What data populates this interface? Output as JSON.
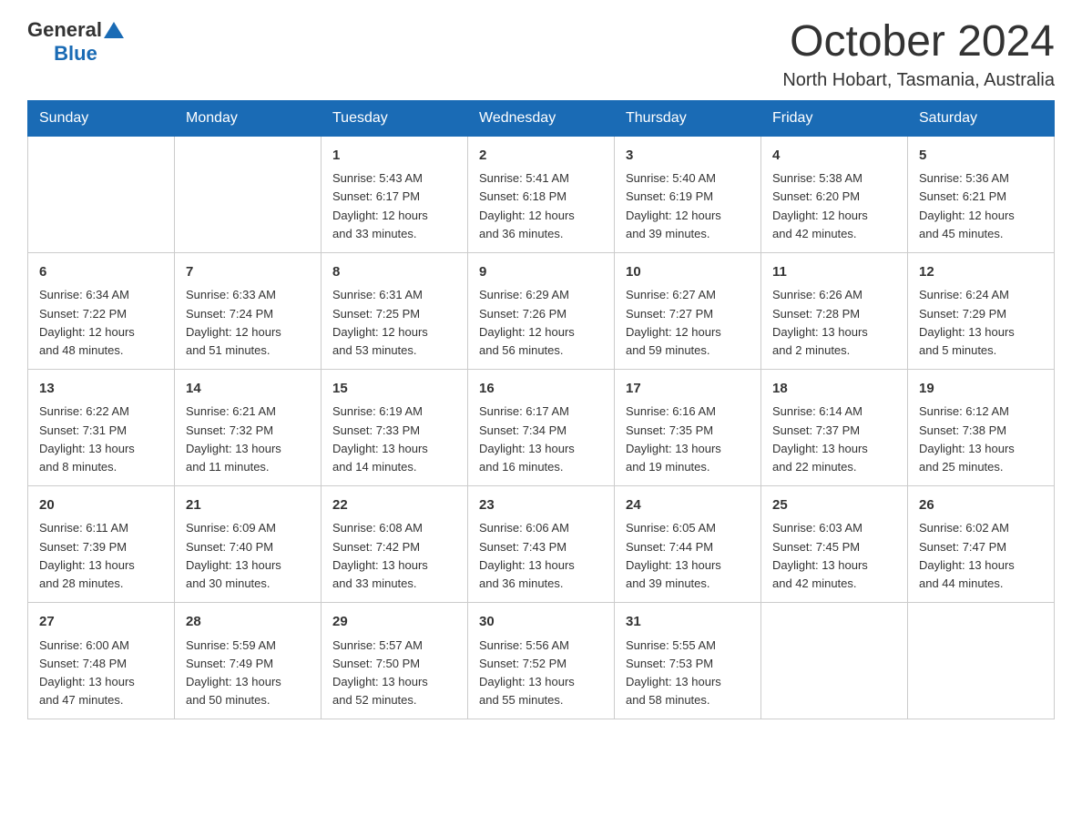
{
  "header": {
    "logo_general": "General",
    "logo_blue": "Blue",
    "month_year": "October 2024",
    "location": "North Hobart, Tasmania, Australia"
  },
  "days_of_week": [
    "Sunday",
    "Monday",
    "Tuesday",
    "Wednesday",
    "Thursday",
    "Friday",
    "Saturday"
  ],
  "weeks": [
    [
      {
        "day": "",
        "info": ""
      },
      {
        "day": "",
        "info": ""
      },
      {
        "day": "1",
        "info": "Sunrise: 5:43 AM\nSunset: 6:17 PM\nDaylight: 12 hours\nand 33 minutes."
      },
      {
        "day": "2",
        "info": "Sunrise: 5:41 AM\nSunset: 6:18 PM\nDaylight: 12 hours\nand 36 minutes."
      },
      {
        "day": "3",
        "info": "Sunrise: 5:40 AM\nSunset: 6:19 PM\nDaylight: 12 hours\nand 39 minutes."
      },
      {
        "day": "4",
        "info": "Sunrise: 5:38 AM\nSunset: 6:20 PM\nDaylight: 12 hours\nand 42 minutes."
      },
      {
        "day": "5",
        "info": "Sunrise: 5:36 AM\nSunset: 6:21 PM\nDaylight: 12 hours\nand 45 minutes."
      }
    ],
    [
      {
        "day": "6",
        "info": "Sunrise: 6:34 AM\nSunset: 7:22 PM\nDaylight: 12 hours\nand 48 minutes."
      },
      {
        "day": "7",
        "info": "Sunrise: 6:33 AM\nSunset: 7:24 PM\nDaylight: 12 hours\nand 51 minutes."
      },
      {
        "day": "8",
        "info": "Sunrise: 6:31 AM\nSunset: 7:25 PM\nDaylight: 12 hours\nand 53 minutes."
      },
      {
        "day": "9",
        "info": "Sunrise: 6:29 AM\nSunset: 7:26 PM\nDaylight: 12 hours\nand 56 minutes."
      },
      {
        "day": "10",
        "info": "Sunrise: 6:27 AM\nSunset: 7:27 PM\nDaylight: 12 hours\nand 59 minutes."
      },
      {
        "day": "11",
        "info": "Sunrise: 6:26 AM\nSunset: 7:28 PM\nDaylight: 13 hours\nand 2 minutes."
      },
      {
        "day": "12",
        "info": "Sunrise: 6:24 AM\nSunset: 7:29 PM\nDaylight: 13 hours\nand 5 minutes."
      }
    ],
    [
      {
        "day": "13",
        "info": "Sunrise: 6:22 AM\nSunset: 7:31 PM\nDaylight: 13 hours\nand 8 minutes."
      },
      {
        "day": "14",
        "info": "Sunrise: 6:21 AM\nSunset: 7:32 PM\nDaylight: 13 hours\nand 11 minutes."
      },
      {
        "day": "15",
        "info": "Sunrise: 6:19 AM\nSunset: 7:33 PM\nDaylight: 13 hours\nand 14 minutes."
      },
      {
        "day": "16",
        "info": "Sunrise: 6:17 AM\nSunset: 7:34 PM\nDaylight: 13 hours\nand 16 minutes."
      },
      {
        "day": "17",
        "info": "Sunrise: 6:16 AM\nSunset: 7:35 PM\nDaylight: 13 hours\nand 19 minutes."
      },
      {
        "day": "18",
        "info": "Sunrise: 6:14 AM\nSunset: 7:37 PM\nDaylight: 13 hours\nand 22 minutes."
      },
      {
        "day": "19",
        "info": "Sunrise: 6:12 AM\nSunset: 7:38 PM\nDaylight: 13 hours\nand 25 minutes."
      }
    ],
    [
      {
        "day": "20",
        "info": "Sunrise: 6:11 AM\nSunset: 7:39 PM\nDaylight: 13 hours\nand 28 minutes."
      },
      {
        "day": "21",
        "info": "Sunrise: 6:09 AM\nSunset: 7:40 PM\nDaylight: 13 hours\nand 30 minutes."
      },
      {
        "day": "22",
        "info": "Sunrise: 6:08 AM\nSunset: 7:42 PM\nDaylight: 13 hours\nand 33 minutes."
      },
      {
        "day": "23",
        "info": "Sunrise: 6:06 AM\nSunset: 7:43 PM\nDaylight: 13 hours\nand 36 minutes."
      },
      {
        "day": "24",
        "info": "Sunrise: 6:05 AM\nSunset: 7:44 PM\nDaylight: 13 hours\nand 39 minutes."
      },
      {
        "day": "25",
        "info": "Sunrise: 6:03 AM\nSunset: 7:45 PM\nDaylight: 13 hours\nand 42 minutes."
      },
      {
        "day": "26",
        "info": "Sunrise: 6:02 AM\nSunset: 7:47 PM\nDaylight: 13 hours\nand 44 minutes."
      }
    ],
    [
      {
        "day": "27",
        "info": "Sunrise: 6:00 AM\nSunset: 7:48 PM\nDaylight: 13 hours\nand 47 minutes."
      },
      {
        "day": "28",
        "info": "Sunrise: 5:59 AM\nSunset: 7:49 PM\nDaylight: 13 hours\nand 50 minutes."
      },
      {
        "day": "29",
        "info": "Sunrise: 5:57 AM\nSunset: 7:50 PM\nDaylight: 13 hours\nand 52 minutes."
      },
      {
        "day": "30",
        "info": "Sunrise: 5:56 AM\nSunset: 7:52 PM\nDaylight: 13 hours\nand 55 minutes."
      },
      {
        "day": "31",
        "info": "Sunrise: 5:55 AM\nSunset: 7:53 PM\nDaylight: 13 hours\nand 58 minutes."
      },
      {
        "day": "",
        "info": ""
      },
      {
        "day": "",
        "info": ""
      }
    ]
  ]
}
